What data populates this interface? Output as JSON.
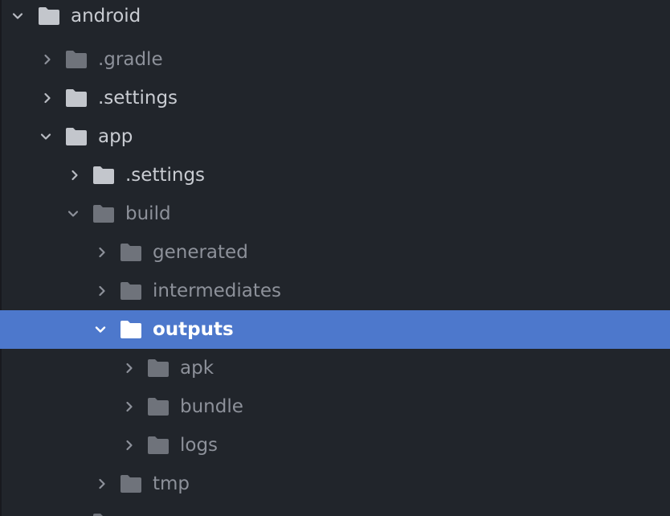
{
  "tree": {
    "items": [
      {
        "label": "android",
        "expanded": true,
        "dim": false
      },
      {
        "label": ".gradle",
        "expanded": false,
        "dim": true
      },
      {
        "label": ".settings",
        "expanded": false,
        "dim": false
      },
      {
        "label": "app",
        "expanded": true,
        "dim": false
      },
      {
        "label": ".settings",
        "expanded": false,
        "dim": false
      },
      {
        "label": "build",
        "expanded": true,
        "dim": true
      },
      {
        "label": "generated",
        "expanded": false,
        "dim": true
      },
      {
        "label": "intermediates",
        "expanded": false,
        "dim": true
      },
      {
        "label": "outputs",
        "expanded": true,
        "dim": false,
        "selected": true
      },
      {
        "label": "apk",
        "expanded": false,
        "dim": true
      },
      {
        "label": "bundle",
        "expanded": false,
        "dim": true
      },
      {
        "label": "logs",
        "expanded": false,
        "dim": true
      },
      {
        "label": "tmp",
        "expanded": false,
        "dim": true
      }
    ]
  },
  "colors": {
    "background": "#21252b",
    "selection": "#4d78cc",
    "text_bright": "#c9ccd2",
    "text_dim": "#8d919a",
    "folder_bright": "#c3c6cc",
    "folder_dim": "#6f737b"
  },
  "icons": {
    "folder": "folder-icon",
    "expanded": "chevron-down-icon",
    "collapsed": "chevron-right-icon"
  }
}
